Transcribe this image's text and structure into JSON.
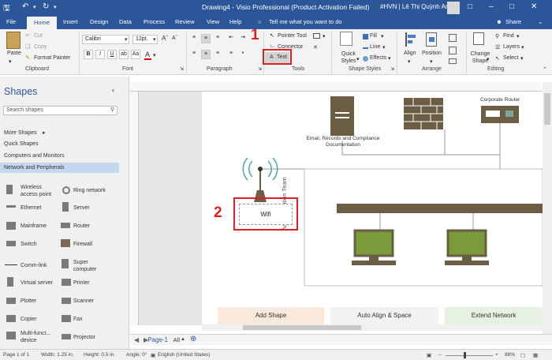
{
  "titlebar": {
    "title": "Drawing4 - Visio Professional (Product Activation Failed)",
    "user": "#HVN | Lê Thị Quỳnh Anh"
  },
  "tabs": [
    "File",
    "Home",
    "Insert",
    "Design",
    "Data",
    "Process",
    "Review",
    "View",
    "Help"
  ],
  "tell_me": "Tell me what you want to do",
  "share": "Share",
  "ribbon": {
    "clipboard": {
      "paste": "Paste",
      "cut": "Cut",
      "copy": "Copy",
      "format_painter": "Format Painter",
      "label": "Clipboard"
    },
    "font": {
      "name": "Calibri",
      "size": "12pt.",
      "label": "Font"
    },
    "paragraph": {
      "label": "Paragraph"
    },
    "tools": {
      "pointer": "Pointer Tool",
      "connector": "Connector",
      "text": "Text",
      "label": "Tools"
    },
    "shape_styles": {
      "quick_styles": "Quick Styles",
      "fill": "Fill",
      "line": "Line",
      "effects": "Effects",
      "label": "Shape Styles"
    },
    "arrange": {
      "align": "Align",
      "position": "Position",
      "label": "Arrange"
    },
    "editing": {
      "change_shape": "Change Shape",
      "find": "Find",
      "layers": "Layers",
      "select": "Select",
      "label": "Editing"
    }
  },
  "annotations": {
    "one": "1",
    "two": "2"
  },
  "shapes_pane": {
    "title": "Shapes",
    "search_placeholder": "Search shapes",
    "links": [
      "More Shapes",
      "Quick Shapes",
      "Computers and Monitors",
      "Network and Peripherals"
    ],
    "items": [
      "Wireless access point",
      "Ring network",
      "Ethernet",
      "Server",
      "Mainframe",
      "Router",
      "Switch",
      "Firewall",
      "Comm-link",
      "Super computer",
      "Virtual server",
      "Printer",
      "Plotter",
      "Scanner",
      "Copier",
      "Fax",
      "Multi-funct... device",
      "Projector"
    ]
  },
  "diagram": {
    "server_label": "Email, Records and Compliance Documentation",
    "router_label": "Corporate Router",
    "admin_label": "Administration Team",
    "wifi_label": "Wifi"
  },
  "quick_tiles": [
    "Add Shape",
    "Auto Align & Space",
    "Extend Network"
  ],
  "page_tabs": {
    "page": "Page-1",
    "all": "All"
  },
  "status": {
    "page": "Page 1 of 1",
    "width": "Width: 1.25 in.",
    "height": "Height: 0.5 in.",
    "angle": "Angle: 0°",
    "language": "English (United States)",
    "zoom": "88%"
  },
  "colors": {
    "brand": "#2b579a",
    "annotation": "#e02020",
    "monitor": "#7b9b3a",
    "dark_shape": "#6b5e45"
  }
}
